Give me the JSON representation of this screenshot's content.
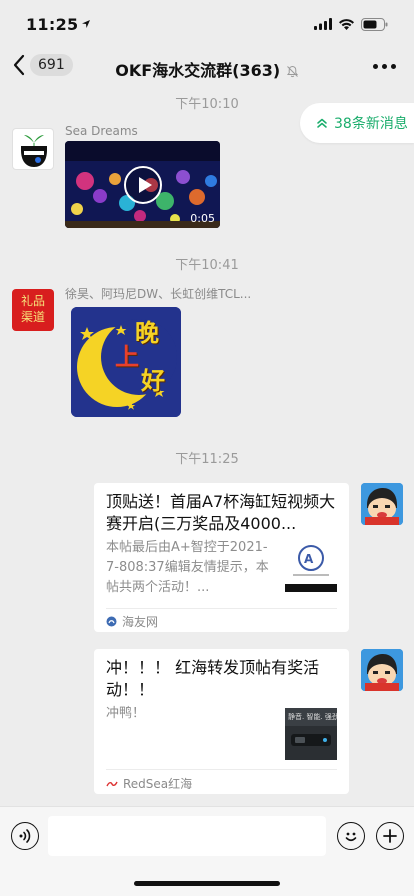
{
  "status_bar": {
    "time": "11:25"
  },
  "nav": {
    "back_count": "691",
    "title": "OKF海水交流群(363)"
  },
  "new_messages_pill": "38条新消息",
  "timestamps": [
    "下午10:10",
    "下午10:41",
    "下午11:25"
  ],
  "messages": [
    {
      "sender": "Sea Dreams",
      "type": "video",
      "duration": "0:05",
      "avatar_text": "Sea Dreams"
    },
    {
      "sender": "徐昊、阿玛尼DW、长虹创维TCL...",
      "type": "sticker",
      "avatar_text": [
        "礼品",
        "渠道"
      ],
      "sticker_text": [
        "晚",
        "上",
        "好"
      ]
    },
    {
      "type": "link_card",
      "title": "顶贴送！首届A7杯海缸短视频大赛开启(三万奖品及4000...",
      "description": "本帖最后由A+智控于2021-7-808:37编辑友情提示，本帖共两个活动！...",
      "source": "海友网"
    },
    {
      "type": "link_card",
      "title": "冲！！！ 红海转发顶帖有奖活动！！",
      "description": "冲鸭！",
      "source": "RedSea红海",
      "thumb_text": "静音. 智能. 强劲"
    }
  ],
  "colors": {
    "accent": "#1aad6c",
    "background": "#ededed"
  }
}
